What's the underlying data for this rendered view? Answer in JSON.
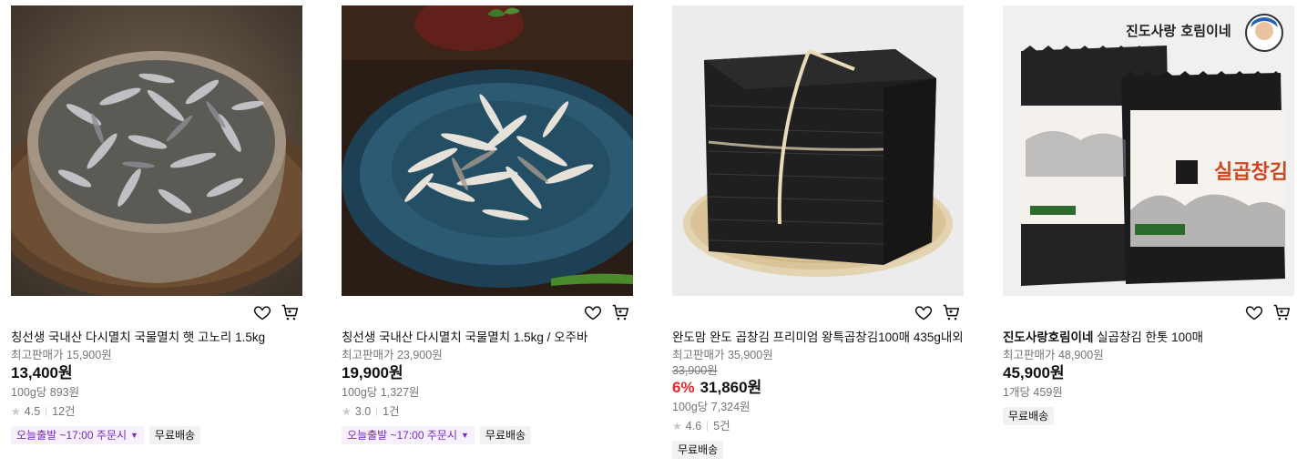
{
  "products": [
    {
      "brand": "",
      "title": "칭선생 국내산 다시멸치 국물멸치 햇 고노리 1.5kg",
      "orig_price": "최고판매가 15,900원",
      "strike_price": "",
      "discount": "",
      "price": "13,400원",
      "unit_price": "100g당 893원",
      "rating": "4.5",
      "reviews": "12건",
      "badge_delivery": "오늘출발 ~17:00 주문시",
      "badge_free": "무료배송"
    },
    {
      "brand": "",
      "title": "칭선생 국내산 다시멸치 국물멸치 1.5kg / 오주바",
      "orig_price": "최고판매가 23,900원",
      "strike_price": "",
      "discount": "",
      "price": "19,900원",
      "unit_price": "100g당 1,327원",
      "rating": "3.0",
      "reviews": "1건",
      "badge_delivery": "오늘출발 ~17:00 주문시",
      "badge_free": "무료배송"
    },
    {
      "brand": "",
      "title": "완도맘 완도 곱창김 프리미엄 왕특곱창김100매 435g내외",
      "orig_price": "최고판매가 35,900원",
      "strike_price": "33,900원",
      "discount": "6%",
      "price": "31,860원",
      "unit_price": "100g당 7,324원",
      "rating": "4.6",
      "reviews": "5건",
      "badge_delivery": "",
      "badge_free": "무료배송"
    },
    {
      "brand": "진도사랑호림이네",
      "title": " 실곱창김 한톳 100매",
      "orig_price": "최고판매가 48,900원",
      "strike_price": "",
      "discount": "",
      "price": "45,900원",
      "unit_price": "1개당 459원",
      "rating": "",
      "reviews": "",
      "badge_delivery": "",
      "badge_free": "무료배송"
    }
  ],
  "image_text": {
    "seller_logo": "진도사랑 호림이네",
    "package_label": "실곱창김"
  },
  "colors": {
    "discount": "#e8282b",
    "delivery_badge": "#7a27c9",
    "muted": "#767676"
  },
  "icons": [
    "heart-icon",
    "cart-icon",
    "star-icon",
    "caret-down-icon"
  ]
}
